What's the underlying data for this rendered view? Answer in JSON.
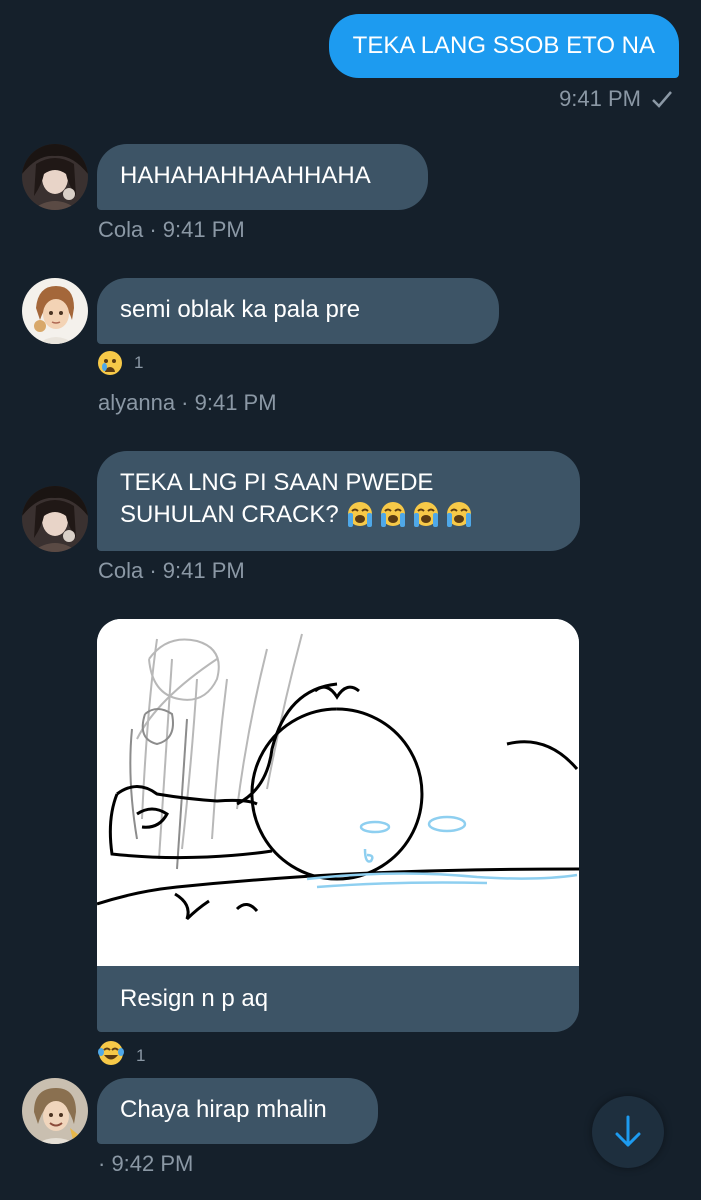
{
  "messages": [
    {
      "id": "m1",
      "direction": "outgoing",
      "text": "TEKA LANG SSOB ETO NA",
      "time": "9:41 PM",
      "status": "sent-check-icon"
    },
    {
      "id": "m2",
      "direction": "incoming",
      "sender": "Cola",
      "text": "HAHAHAHHAAHHAHA",
      "meta": "Cola · 9:41 PM"
    },
    {
      "id": "m3",
      "direction": "incoming",
      "sender": "alyanna",
      "text": "semi oblak ka pala pre",
      "reaction": {
        "icon": "crying-face-icon",
        "count": "1"
      },
      "meta": "alyanna · 9:41 PM"
    },
    {
      "id": "m4",
      "direction": "incoming",
      "sender": "Cola",
      "line1": "TEKA LNG PI SAAN PWEDE",
      "line2": "SUHULAN CRACK?",
      "meta": "Cola · 9:41 PM"
    },
    {
      "id": "m5",
      "direction": "incoming",
      "sender": "",
      "image": "sad-doodle-drawing",
      "caption": "Resign n p aq",
      "reaction": {
        "icon": "tears-of-joy-icon",
        "count": "1"
      }
    },
    {
      "id": "m6",
      "direction": "incoming",
      "sender": "",
      "text": "Chaya hirap mhalin",
      "meta": " · 9:42 PM"
    }
  ],
  "scroll_button": {
    "icon": "arrow-down-icon"
  },
  "colors": {
    "background": "#15202b",
    "outgoing": "#1d9bf0",
    "incoming": "#3d5466",
    "meta": "#8b98a5"
  }
}
